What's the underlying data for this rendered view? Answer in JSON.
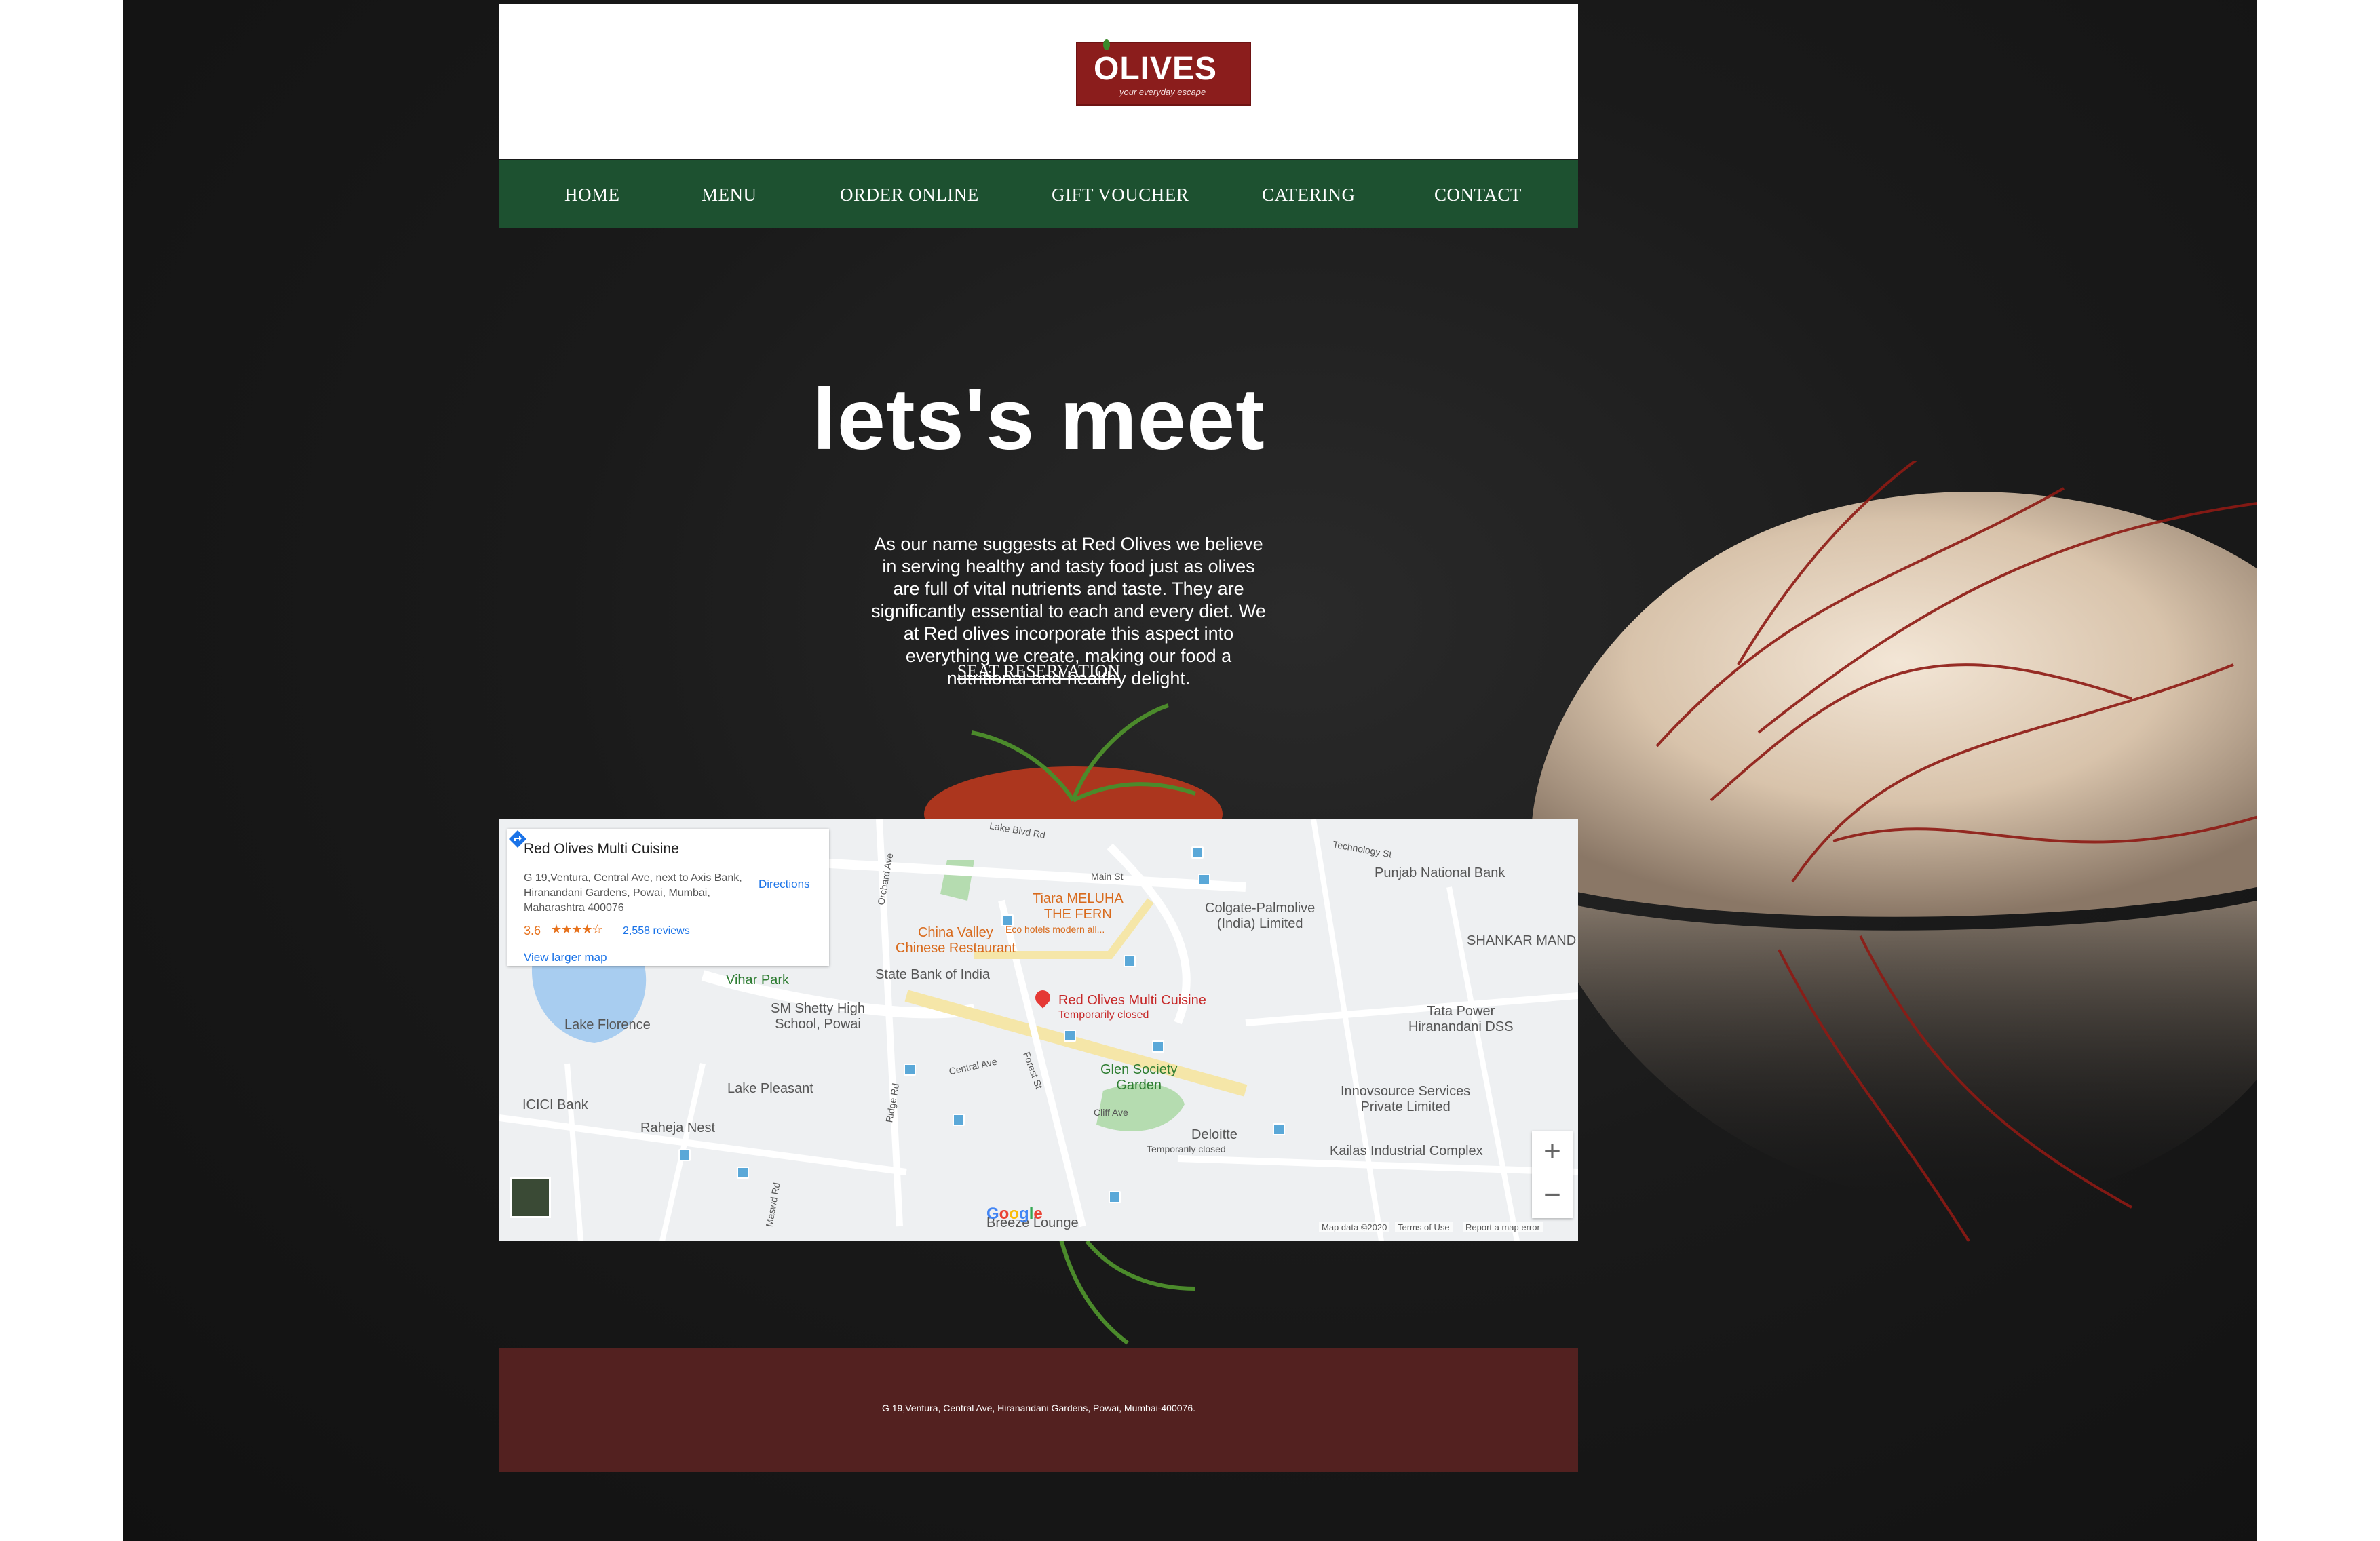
{
  "logo": {
    "wordmark": "OLIVES",
    "tagline": "your everyday escape"
  },
  "nav": {
    "items": [
      "HOME",
      "MENU",
      "ORDER ONLINE",
      "GIFT VOUCHER",
      "CATERING",
      "CONTACT"
    ]
  },
  "hero": {
    "title": "lets's meet",
    "text": "As our name suggests at Red Olives we believe in serving healthy and tasty food just as olives are full of vital nutrients and taste. They are significantly essential to each and every diet. We at Red olives incorporate this aspect into everything we create, making our food a nutritional and healthy delight.",
    "reservation_link": "SEAT RESERVATION"
  },
  "map": {
    "infocard": {
      "title": "Red Olives Multi Cuisine",
      "address": "G 19,Ventura, Central Ave, next to Axis Bank, Hiranandani Gardens, Powai, Mumbai, Maharashtra 400076",
      "rating": "3.6",
      "stars": "★★★★☆",
      "reviews": "2,558 reviews",
      "larger_map": "View larger map",
      "directions": "Directions"
    },
    "labels": {
      "place_main": "Red Olives Multi Cuisine",
      "place_main_status": "Temporarily closed",
      "china_valley": "China Valley\nChinese Restaurant",
      "tiara": "Tiara MELUHA\nTHE FERN",
      "tiara_sub": "Eco hotels modern all...",
      "colgate": "Colgate-Palmolive\n(India) Limited",
      "punjab": "Punjab National Bank",
      "shankar": "SHANKAR MAND",
      "sbi": "State Bank of India",
      "vihar": "Vihar Park",
      "sm_shetty": "SM Shetty High\nSchool, Powai",
      "lake_florence": "Lake Florence",
      "lake_pleasant": "Lake Pleasant",
      "icici": "ICICI Bank",
      "raheja": "Raheja Nest",
      "glen": "Glen Society\nGarden",
      "deloitte": "Deloitte",
      "deloitte_status": "Temporarily closed",
      "tata": "Tata Power\nHiranandani DSS",
      "innovsource": "Innovsource Services\nPrivate Limited",
      "kailas": "Kailas Industrial Complex",
      "breeze": "Breeze Lounge",
      "technology_st": "Technology St",
      "main_st": "Main St",
      "central_ave": "Central Ave",
      "cliff_ave": "Cliff Ave",
      "orchard_ave": "Orchard Ave",
      "ridge_rd": "Ridge Rd",
      "forest_st": "Forest St",
      "lake_blvd": "Lake Blvd Rd",
      "mvd_rd": "Maswd Rd"
    },
    "google": "Google",
    "map_data": "Map data ©2020",
    "terms": "Terms of Use",
    "report": "Report a map error",
    "zoom_in": "+",
    "zoom_out": "−"
  },
  "footer": {
    "address": "G 19,Ventura, Central Ave, Hiranandani Gardens, Powai, Mumbai-400076."
  },
  "colors": {
    "nav": "#1d5130",
    "footer": "#532120",
    "logo": "#8b1d1c",
    "background": "#1a1a1a"
  }
}
